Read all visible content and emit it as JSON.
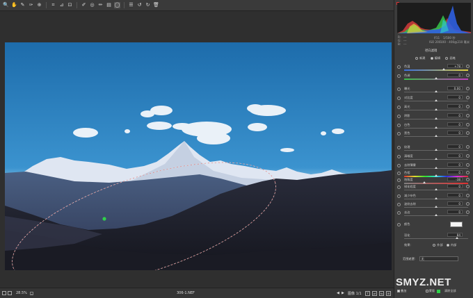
{
  "toolbar": {
    "tools": [
      "zoom-tool",
      "hand-tool",
      "white-balance-tool",
      "color-sampler-tool",
      "targeted-adjustment-tool",
      "crop-tool",
      "straighten-tool",
      "transform-tool",
      "spot-removal-tool",
      "red-eye-tool",
      "adjustment-brush-tool",
      "graduated-filter-tool",
      "radial-filter-tool",
      "preferences-icon",
      "rotate-ccw-icon",
      "rotate-cw-icon",
      "trash-icon"
    ],
    "selected": "radial-filter-tool"
  },
  "status": {
    "zoom": "28.5%",
    "filename": "306-1.NEF",
    "image_count": "图像 1/1"
  },
  "camera_info": {
    "r_label": "R:",
    "g_label": "G:",
    "b_label": "B:",
    "rgb_dash": "---",
    "aperture": "f/11",
    "shutter": "1/500 秒",
    "iso": "ISO 200",
    "lens": "100 - 400@210 毫米"
  },
  "panel": {
    "title": "径向滤镜",
    "mode_new": "新建",
    "mode_edit": "编辑",
    "mode_brush": "画笔",
    "adjustments": [
      {
        "label": "色温",
        "value": "+78",
        "pos": 0.62,
        "colored": "temp"
      },
      {
        "label": "色调",
        "value": "0",
        "pos": 0.5,
        "colored": "tint"
      },
      {
        "label": "曝光",
        "value": "0.00",
        "pos": 0.5
      },
      {
        "label": "对比度",
        "value": "0",
        "pos": 0.5
      },
      {
        "label": "高光",
        "value": "0",
        "pos": 0.5
      },
      {
        "label": "阴影",
        "value": "0",
        "pos": 0.5
      },
      {
        "label": "白色",
        "value": "0",
        "pos": 0.5
      },
      {
        "label": "黑色",
        "value": "0",
        "pos": 0.5
      },
      {
        "label": "纹理",
        "value": "0",
        "pos": 0.5
      },
      {
        "label": "清晰度",
        "value": "0",
        "pos": 0.5
      },
      {
        "label": "去除薄雾",
        "value": "0",
        "pos": 0.5
      },
      {
        "label": "色相",
        "value": "0",
        "pos": 0.5,
        "colored": "hue"
      },
      {
        "label": "饱和度",
        "value": "-38",
        "pos": 0.32,
        "colored": "sat"
      },
      {
        "label": "锐化程度",
        "value": "0",
        "pos": 0.5
      },
      {
        "label": "减少杂色",
        "value": "0",
        "pos": 0.5
      },
      {
        "label": "波纹去除",
        "value": "0",
        "pos": 0.5
      },
      {
        "label": "去边",
        "value": "0",
        "pos": 0.5
      }
    ],
    "color_label": "颜色",
    "feather_label": "羽化",
    "feather_value": "84",
    "effect_label": "效果:",
    "effect_outside": "外部",
    "effect_inside": "内部",
    "mask_label": "范围遮罩:",
    "mask_value": "无",
    "overlay_label": "叠加",
    "mask_toggle_label": "蒙版",
    "clear_all": "清除全部"
  },
  "watermark": "SMYZ.NET",
  "colors": {
    "accent_green": "#2fd14a",
    "panel_bg": "#3c3c3c"
  }
}
